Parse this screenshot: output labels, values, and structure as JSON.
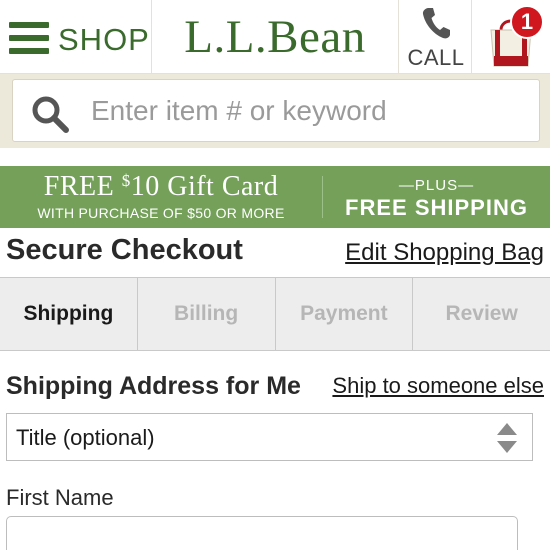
{
  "header": {
    "shop_label": "SHOP",
    "logo_text": "L.L.Bean",
    "call_label": "CALL",
    "cart_count": "1",
    "brand_color": "#3a6a2c",
    "badge_color": "#d0161e"
  },
  "search": {
    "placeholder": "Enter item # or keyword",
    "value": ""
  },
  "promo": {
    "free": "FREE",
    "amount_symbol": "$",
    "amount": "10 Gift Card",
    "subtext": "WITH PURCHASE OF $50 OR MORE",
    "plus": "—PLUS—",
    "free_shipping": "FREE SHIPPING",
    "background": "#74a05a"
  },
  "checkout": {
    "title": "Secure Checkout",
    "edit_bag": "Edit Shopping Bag",
    "steps": [
      {
        "label": "Shipping",
        "active": true
      },
      {
        "label": "Billing",
        "active": false
      },
      {
        "label": "Payment",
        "active": false
      },
      {
        "label": "Review",
        "active": false
      }
    ]
  },
  "shipping_form": {
    "title": "Shipping Address for Me",
    "ship_to_other": "Ship to someone else",
    "title_select_value": "Title (optional)",
    "first_name_label": "First Name",
    "first_name_value": ""
  },
  "icons": [
    "menu-icon",
    "phone-icon",
    "shopping-bag-icon",
    "search-icon",
    "select-updown-icon"
  ]
}
